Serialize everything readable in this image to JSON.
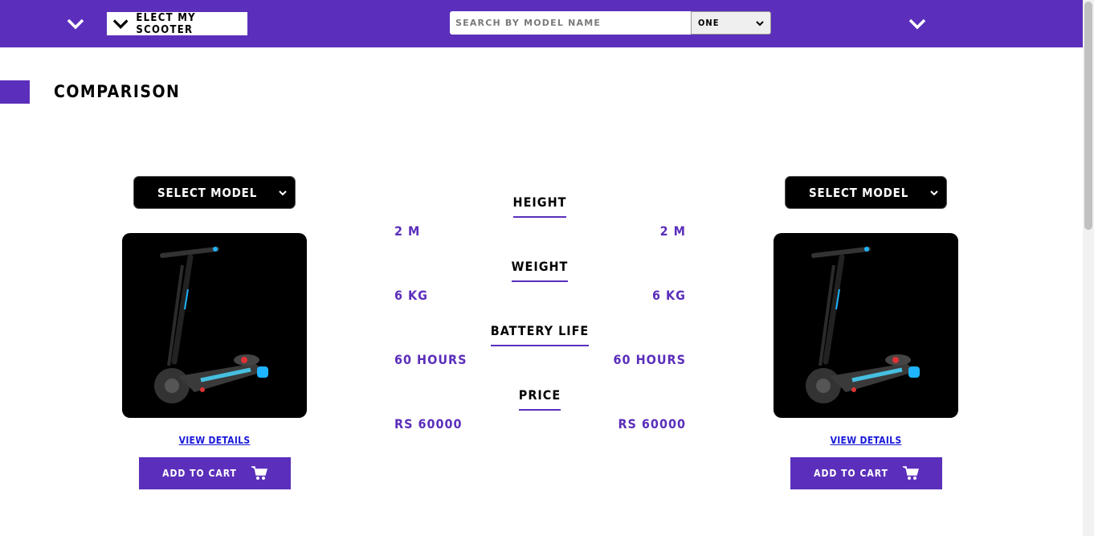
{
  "header": {
    "brand": "ELECT MY SCOOTER",
    "search_placeholder": "SEARCH BY MODEL NAME",
    "search_type": "ONE"
  },
  "page": {
    "title": "COMPARISON"
  },
  "left_product": {
    "model_select": "SELECT MODEL",
    "view_details": "VIEW DETAILS",
    "add_to_cart": "ADD TO CART"
  },
  "right_product": {
    "model_select": "SELECT MODEL",
    "view_details": "VIEW DETAILS",
    "add_to_cart": "ADD TO CART"
  },
  "specs": [
    {
      "label": "HEIGHT",
      "left": "2 M",
      "right": "2 M"
    },
    {
      "label": "WEIGHT",
      "left": "6 KG",
      "right": "6 KG"
    },
    {
      "label": "BATTERY LIFE",
      "left": "60 HOURS",
      "right": "60 HOURS"
    },
    {
      "label": "PRICE",
      "left": "RS 60000",
      "right": "RS 60000"
    }
  ],
  "colors": {
    "accent": "#5b2fbb",
    "link": "#1a1ad8",
    "dark": "#000000"
  }
}
